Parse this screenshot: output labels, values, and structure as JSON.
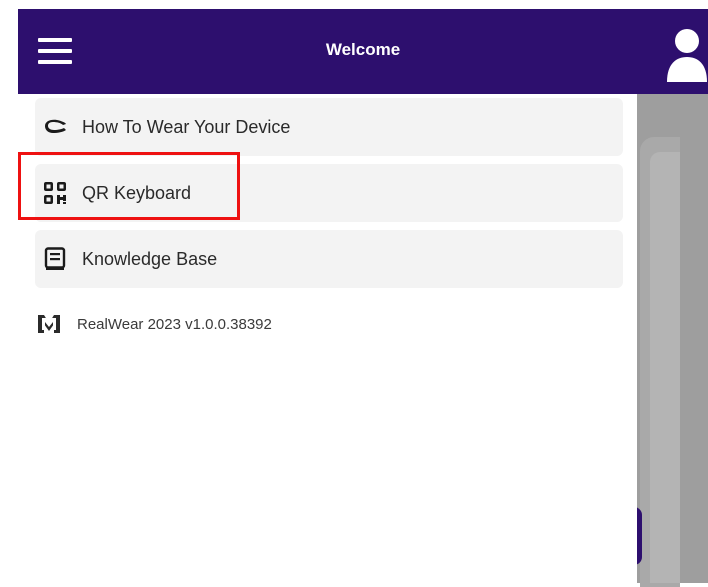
{
  "header": {
    "title": "Welcome",
    "background": "#2d0f6e"
  },
  "menu": {
    "items": [
      {
        "label": "How To Wear Your Device",
        "icon": "headset-icon"
      },
      {
        "label": "QR Keyboard",
        "icon": "qr-code-icon"
      },
      {
        "label": "Knowledge Base",
        "icon": "book-icon"
      }
    ]
  },
  "footer": {
    "version_text": "RealWear 2023 v1.0.0.38392",
    "logo_icon": "realwear-logo"
  },
  "highlight_color": "#ee1111"
}
